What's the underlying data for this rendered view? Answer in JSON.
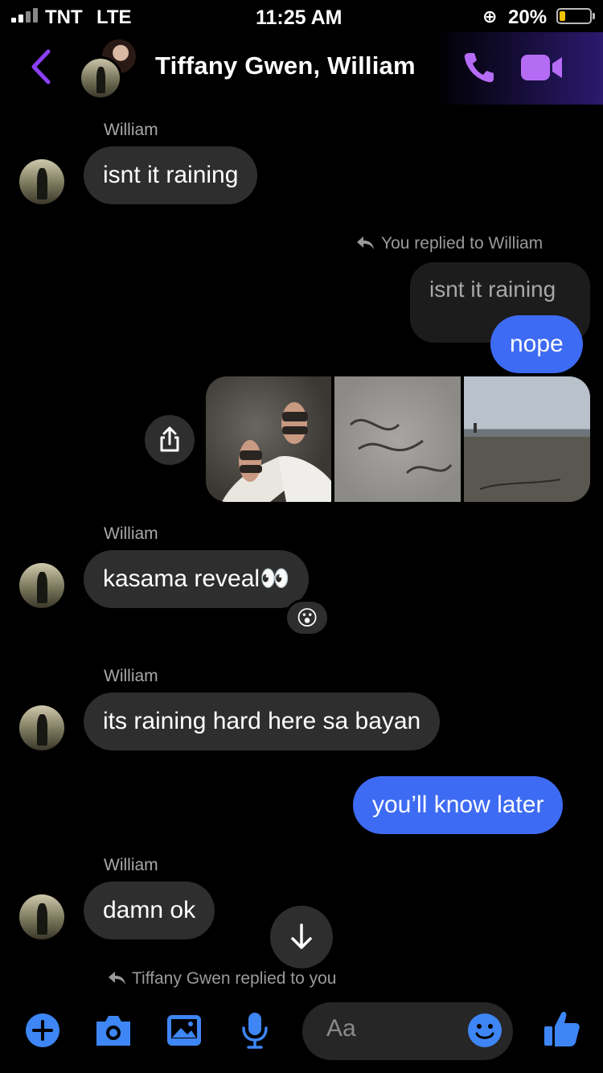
{
  "status": {
    "carrier": "TNT",
    "network": "LTE",
    "time": "11:25 AM",
    "battery": "20%",
    "battery_level": 0.2
  },
  "header": {
    "title": "Tiffany Gwen, William",
    "accent": "#9b5cf6"
  },
  "messages": {
    "m1": {
      "sender": "William",
      "text": "isnt it raining"
    },
    "reply_note": "You replied to William",
    "quoted": "isnt it raining",
    "m2": {
      "text": "nope"
    },
    "m3": {
      "sender": "William",
      "text": "kasama reveal👀",
      "reaction": "😮"
    },
    "m4": {
      "sender": "William",
      "text": "its raining hard here sa bayan"
    },
    "m5": {
      "text": "you’ll know later"
    },
    "m6": {
      "sender": "William",
      "text": "damn ok"
    },
    "reply_note2": "Tiffany Gwen replied to you"
  },
  "composer": {
    "placeholder": "Aa"
  },
  "colors": {
    "outgoing": "#3e6bf3",
    "incoming": "#2e2e2e",
    "composer_icons": "#3e86f5"
  }
}
